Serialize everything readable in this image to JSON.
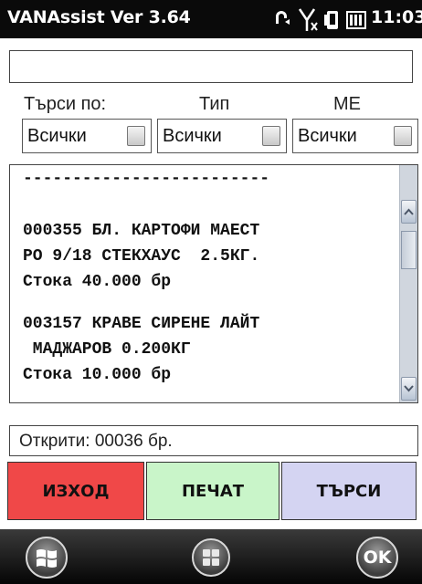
{
  "statusbar": {
    "title": "VANAssist Ver 3.64",
    "time": "11:03",
    "icons": [
      "sync-icon",
      "no-signal-icon",
      "device-icon",
      "battery-icon"
    ]
  },
  "search_field": {
    "value": ""
  },
  "filters": {
    "search_by": {
      "label": "Търси по:",
      "value": "Всички"
    },
    "type": {
      "label": "Тип",
      "value": "Всички"
    },
    "unit": {
      "label": "МЕ",
      "value": "Всички"
    }
  },
  "results": {
    "separator": "-------------------------",
    "items": [
      {
        "line1": "000355 БЛ. КАРТОФИ МАЕСТ",
        "line2": "РО 9/18 СТЕКХАУС  2.5КГ.",
        "stock": "Стока 40.000 бр"
      },
      {
        "line1": "003157 КРАВЕ СИРЕНЕ ЛАЙТ",
        "line2": " МАДЖАРОВ 0.200КГ",
        "stock": "Стока 10.000 бр"
      }
    ]
  },
  "found_text": "Открити: 00036 бр.",
  "buttons": {
    "exit": "ИЗХОД",
    "print": "ПЕЧАТ",
    "search": "ТЪРСИ"
  },
  "taskbar": {
    "ok": "OK"
  },
  "colors": {
    "exit": "#f04848",
    "print": "#c9f5c9",
    "search": "#d4d4f2",
    "statusbar": "#0a0a0a"
  }
}
